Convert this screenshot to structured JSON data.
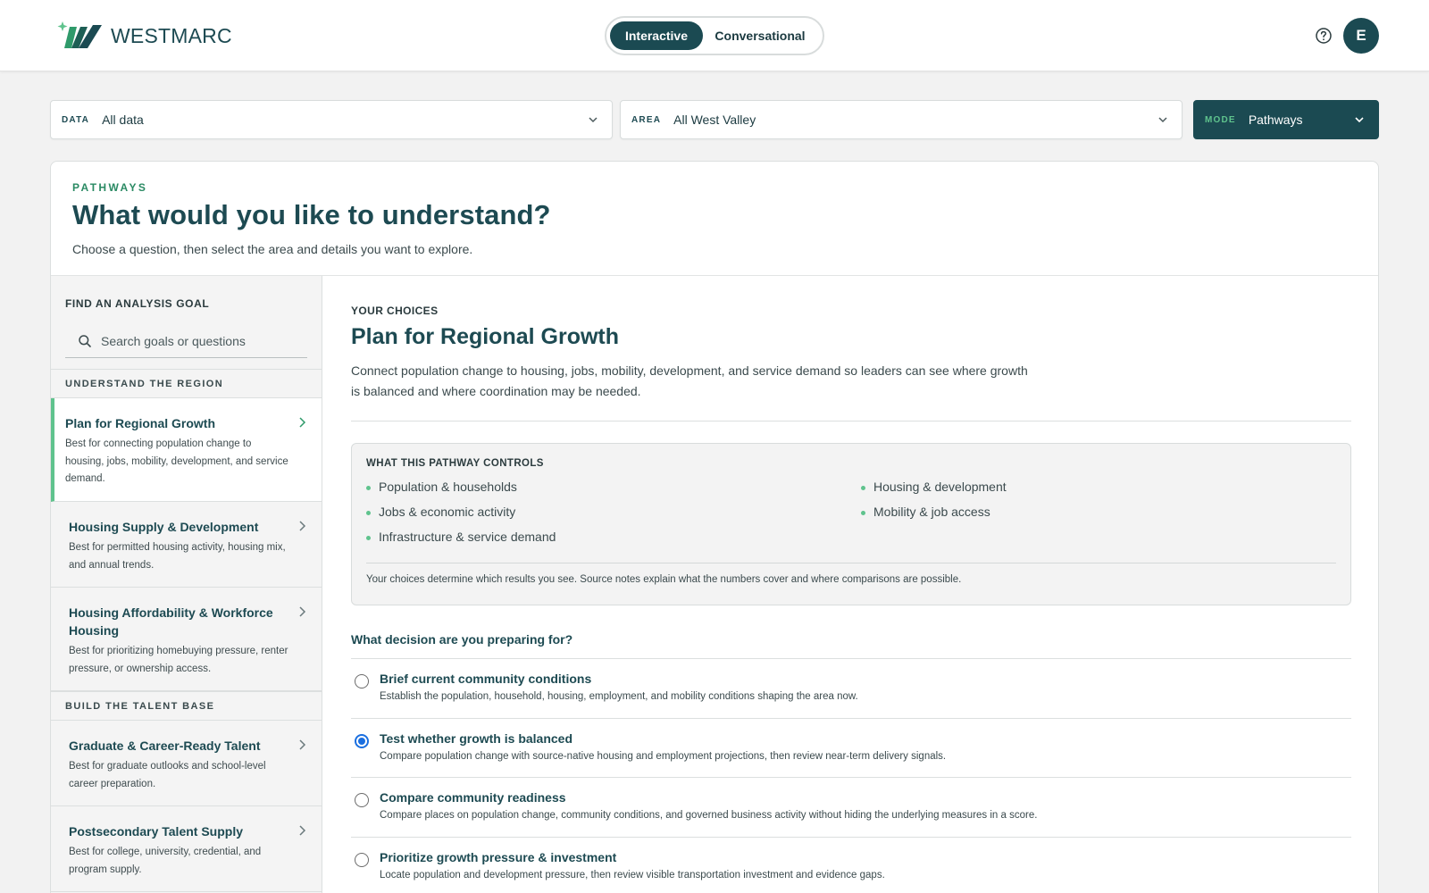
{
  "brand": {
    "name": "WESTMARC"
  },
  "header": {
    "mode_toggle": {
      "active": "Interactive",
      "inactive": "Conversational"
    },
    "avatar_initial": "E"
  },
  "filters": [
    {
      "label": "DATA",
      "value": "All data"
    },
    {
      "label": "AREA",
      "value": "All West Valley"
    },
    {
      "label": "MODE",
      "value": "Pathways"
    }
  ],
  "hero": {
    "eyebrow": "PATHWAYS",
    "title": "What would you like to understand?",
    "subtitle": "Choose a question, then select the area and details you want to explore."
  },
  "sidebar": {
    "search_label": "FIND AN ANALYSIS GOAL",
    "search_placeholder": "Search goals or questions",
    "groups": [
      {
        "heading": "UNDERSTAND THE REGION",
        "goals": [
          {
            "title": "Plan for Regional Growth",
            "desc": "Best for connecting population change to housing, jobs, mobility, development, and service demand.",
            "active": true
          },
          {
            "title": "Housing Supply & Development",
            "desc": "Best for permitted housing activity, housing mix, and annual trends.",
            "active": false
          },
          {
            "title": "Housing Affordability & Workforce Housing",
            "desc": "Best for prioritizing homebuying pressure, renter pressure, or ownership access.",
            "active": false
          }
        ]
      },
      {
        "heading": "BUILD THE TALENT BASE",
        "goals": [
          {
            "title": "Graduate & Career-Ready Talent",
            "desc": "Best for graduate outlooks and school-level career preparation.",
            "active": false
          },
          {
            "title": "Postsecondary Talent Supply",
            "desc": "Best for college, university, credential, and program supply.",
            "active": false
          }
        ]
      }
    ]
  },
  "content": {
    "label": "YOUR CHOICES",
    "title": "Plan for Regional Growth",
    "description": "Connect population change to housing, jobs, mobility, development, and service demand so leaders can see where growth is balanced and where coordination may be needed.",
    "controls": {
      "heading": "WHAT THIS PATHWAY CONTROLS",
      "items": [
        "Population & households",
        "Housing & development",
        "Jobs & economic activity",
        "Mobility & job access",
        "Infrastructure & service demand"
      ],
      "note": "Your choices determine which results you see. Source notes explain what the numbers cover and where comparisons are possible."
    },
    "question": "What decision are you preparing for?",
    "options": [
      {
        "title": "Brief current community conditions",
        "desc": "Establish the population, household, housing, employment, and mobility conditions shaping the area now.",
        "checked": false
      },
      {
        "title": "Test whether growth is balanced",
        "desc": "Compare population change with source-native housing and employment projections, then review near-term delivery signals.",
        "checked": true
      },
      {
        "title": "Compare community readiness",
        "desc": "Compare places on population change, community conditions, and governed business activity without hiding the underlying measures in a score.",
        "checked": false
      },
      {
        "title": "Prioritize growth pressure & investment",
        "desc": "Locate population and development pressure, then review visible transportation investment and evidence gaps.",
        "checked": false
      }
    ]
  },
  "colors": {
    "brand_dark": "#1b4a52",
    "accent_green": "#5fc38d",
    "radio_blue": "#1a6fe0"
  }
}
